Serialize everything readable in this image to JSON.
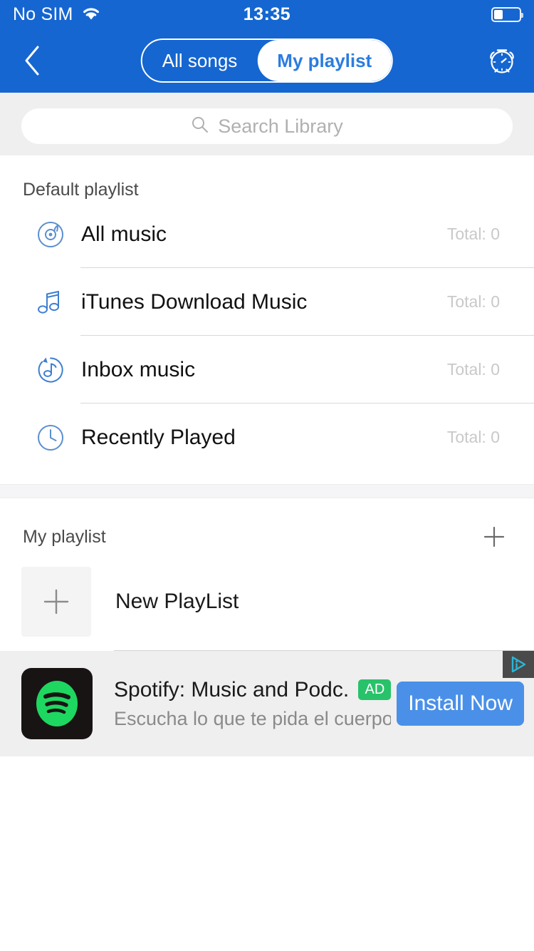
{
  "status_bar": {
    "carrier": "No SIM",
    "wifi_icon": "wifi-icon",
    "time": "13:35",
    "battery_icon": "battery-icon",
    "battery_level_percent": 35
  },
  "nav": {
    "back_icon": "chevron-left-icon",
    "alarm_icon": "alarm-clock-icon",
    "segments": [
      {
        "label": "All songs",
        "active": false
      },
      {
        "label": "My playlist",
        "active": true
      }
    ]
  },
  "search": {
    "icon": "search-icon",
    "placeholder": "Search Library",
    "value": ""
  },
  "default_playlist": {
    "title": "Default playlist",
    "items": [
      {
        "label": "All music",
        "total": "Total: 0",
        "icon": "disc-icon"
      },
      {
        "label": "iTunes Download Music",
        "total": "Total: 0",
        "icon": "music-note-icon"
      },
      {
        "label": "Inbox music",
        "total": "Total: 0",
        "icon": "inbox-music-icon"
      },
      {
        "label": "Recently Played",
        "total": "Total: 0",
        "icon": "clock-icon"
      }
    ]
  },
  "my_playlist": {
    "title": "My playlist",
    "add_icon": "plus-icon",
    "new_playlist": {
      "label": "New PlayList",
      "icon": "plus-icon"
    }
  },
  "ad": {
    "adchoices_icon": "adchoices-icon",
    "app_icon": "spotify-icon",
    "title": "Spotify: Music and Podc...",
    "badge": "AD",
    "subtitle": "Escucha lo que te pida el cuerpo,...",
    "cta_label": "Install Now"
  },
  "colors": {
    "header_blue": "#1566D1",
    "accent_blue": "#2B7CE0",
    "icon_blue": "#5B8FD0",
    "ad_badge_green": "#28C26A",
    "ad_cta_blue": "#4A90E8",
    "page_gray": "#EFEFEF"
  }
}
